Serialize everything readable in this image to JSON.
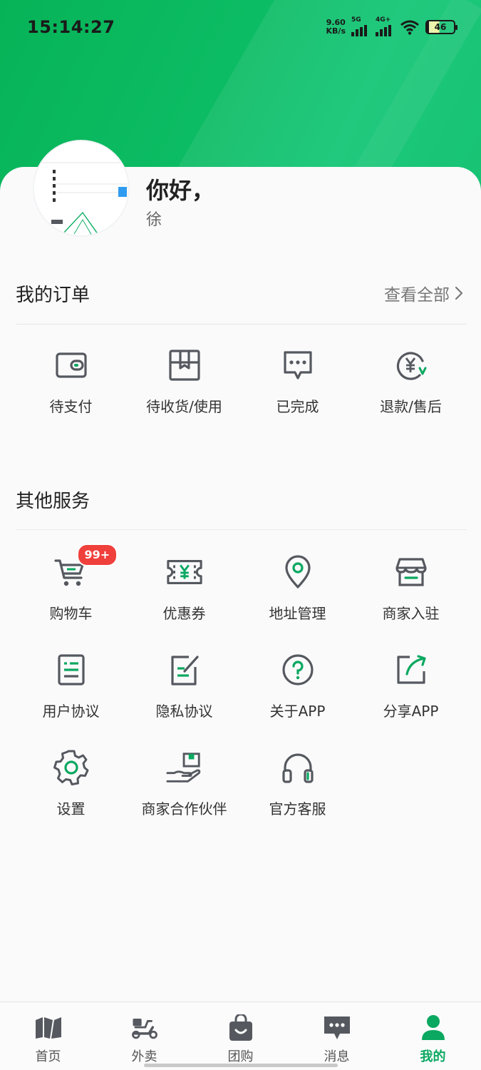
{
  "status_bar": {
    "time": "15:14:27",
    "net_speed": "9.60",
    "net_unit": "KB/s",
    "signal1": "5G",
    "signal2": "4G+",
    "battery": "46"
  },
  "profile": {
    "greeting": "你好，",
    "username": "徐"
  },
  "orders": {
    "title": "我的订单",
    "view_all": "查看全部",
    "items": [
      {
        "label": "待支付",
        "icon": "wallet-icon"
      },
      {
        "label": "待收货/使用",
        "icon": "package-icon"
      },
      {
        "label": "已完成",
        "icon": "chat-done-icon"
      },
      {
        "label": "退款/售后",
        "icon": "refund-icon"
      }
    ]
  },
  "services": {
    "title": "其他服务",
    "items": [
      {
        "label": "购物车",
        "icon": "cart-icon",
        "badge": "99+"
      },
      {
        "label": "优惠券",
        "icon": "coupon-icon"
      },
      {
        "label": "地址管理",
        "icon": "location-icon"
      },
      {
        "label": "商家入驻",
        "icon": "store-icon"
      },
      {
        "label": "用户协议",
        "icon": "document-icon"
      },
      {
        "label": "隐私协议",
        "icon": "edit-document-icon"
      },
      {
        "label": "关于APP",
        "icon": "question-icon"
      },
      {
        "label": "分享APP",
        "icon": "share-icon"
      },
      {
        "label": "设置",
        "icon": "gear-icon"
      },
      {
        "label": "商家合作伙伴",
        "icon": "partner-hand-icon"
      },
      {
        "label": "官方客服",
        "icon": "headset-icon"
      }
    ]
  },
  "tabbar": {
    "items": [
      {
        "label": "首页",
        "icon": "home-map-icon"
      },
      {
        "label": "外卖",
        "icon": "scooter-icon"
      },
      {
        "label": "团购",
        "icon": "shopping-bag-icon"
      },
      {
        "label": "消息",
        "icon": "message-icon"
      },
      {
        "label": "我的",
        "icon": "user-icon"
      }
    ],
    "active": "我的"
  },
  "colors": {
    "accent": "#0aa860",
    "header_green": "#0cbc64",
    "icon_dark": "#55595f",
    "badge_red": "#f0403c"
  }
}
